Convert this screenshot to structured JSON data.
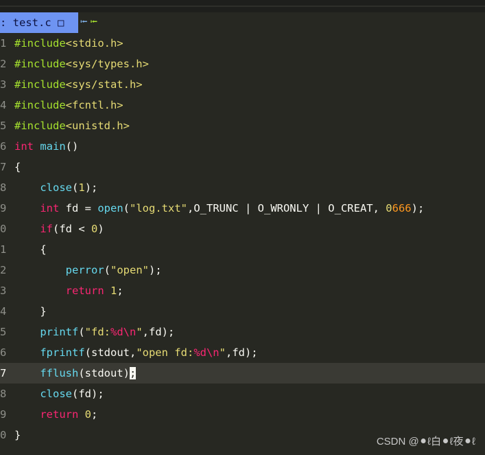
{
  "tab": {
    "label": ": test.c ",
    "box": "□",
    "arrow_left": "⭰",
    "arrow_left2": "⭰"
  },
  "line_numbers": [
    "1",
    "2",
    "3",
    "4",
    "5",
    "6",
    "7",
    "8",
    "9",
    "0",
    "1",
    "2",
    "3",
    "4",
    "5",
    "6",
    "7",
    "8",
    "9",
    "0"
  ],
  "code": {
    "l1": {
      "pp": "#include",
      "inc": "<stdio.h>"
    },
    "l2": {
      "pp": "#include",
      "inc": "<sys/types.h>"
    },
    "l3": {
      "pp": "#include",
      "inc": "<sys/stat.h>"
    },
    "l4": {
      "pp": "#include",
      "inc": "<fcntl.h>"
    },
    "l5": {
      "pp": "#include",
      "inc": "<unistd.h>"
    },
    "l6": {
      "kw": "int",
      "fn": " main",
      "rest": "()"
    },
    "l7": {
      "rest": "{"
    },
    "l8": {
      "indent": "    ",
      "fn": "close",
      "p1": "(",
      "num": "1",
      "p2": ");"
    },
    "l9": {
      "indent": "    ",
      "kw": "int",
      "a": " fd = ",
      "fn": "open",
      "b": "(",
      "str": "\"log.txt\"",
      "c": ",O_TRUNC | O_WRONLY | O_CREAT, ",
      "num": "0",
      "num2": "666",
      "d": ");"
    },
    "l10": {
      "indent": "    ",
      "kw": "if",
      "a": "(fd < ",
      "num": "0",
      "b": ")"
    },
    "l11": {
      "indent": "    ",
      "rest": "{"
    },
    "l12": {
      "indent": "        ",
      "fn": "perror",
      "a": "(",
      "str": "\"open\"",
      "b": ");"
    },
    "l13": {
      "indent": "        ",
      "kw": "return",
      "a": " ",
      "num": "1",
      "b": ";"
    },
    "l14": {
      "indent": "    ",
      "rest": "}"
    },
    "l15": {
      "indent": "    ",
      "fn": "printf",
      "a": "(",
      "s1": "\"fd:",
      "fmt": "%d\\n",
      "s2": "\"",
      "b": ",fd);"
    },
    "l16": {
      "indent": "    ",
      "fn": "fprintf",
      "a": "(stdout,",
      "s1": "\"open fd:",
      "fmt": "%d\\n",
      "s2": "\"",
      "b": ",fd);"
    },
    "l17": {
      "indent": "    ",
      "fn": "fflush",
      "a": "(stdout)",
      "cursor": ";"
    },
    "l18": {
      "indent": "    ",
      "fn": "close",
      "a": "(fd);"
    },
    "l19": {
      "indent": "    ",
      "kw": "return",
      "a": " ",
      "num": "0",
      "b": ";"
    },
    "l20": {
      "rest": "}"
    }
  },
  "watermark": "CSDN @⚫ℓ白⚫ℓ夜⚫ℓ"
}
